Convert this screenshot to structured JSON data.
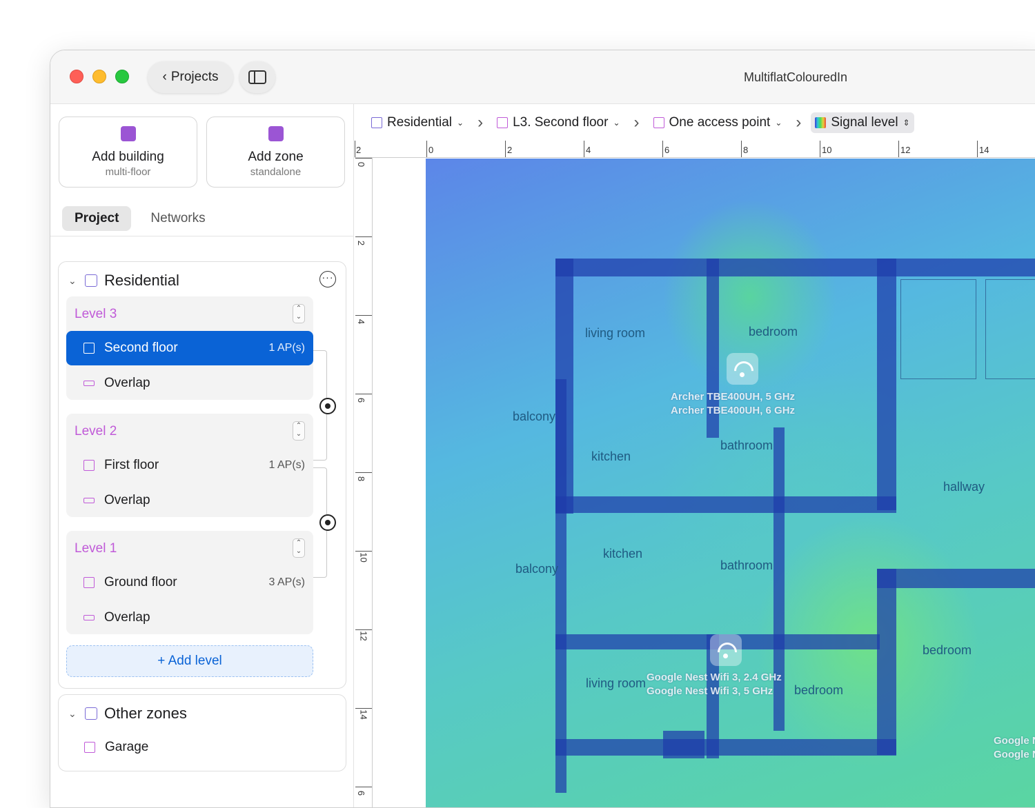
{
  "window": {
    "title": "MultiflatColouredIn",
    "back_label": "Projects"
  },
  "sidebar": {
    "add_building": {
      "title": "Add building",
      "subtitle": "multi-floor"
    },
    "add_zone": {
      "title": "Add zone",
      "subtitle": "standalone"
    },
    "tabs": [
      {
        "label": "Project",
        "active": true
      },
      {
        "label": "Networks",
        "active": false
      }
    ],
    "building": {
      "name": "Residential",
      "levels": [
        {
          "label": "Level 3",
          "floors": [
            {
              "name": "Second floor",
              "aps": "1 AP(s)",
              "selected": true
            },
            {
              "name": "Overlap",
              "aps": ""
            }
          ]
        },
        {
          "label": "Level 2",
          "floors": [
            {
              "name": "First floor",
              "aps": "1 AP(s)"
            },
            {
              "name": "Overlap",
              "aps": ""
            }
          ]
        },
        {
          "label": "Level 1",
          "floors": [
            {
              "name": "Ground floor",
              "aps": "3 AP(s)"
            },
            {
              "name": "Overlap",
              "aps": ""
            }
          ]
        }
      ],
      "add_level": "+ Add level"
    },
    "other_zones": {
      "title": "Other zones",
      "items": [
        "Garage"
      ]
    }
  },
  "breadcrumbs": [
    {
      "label": "Residential",
      "icon": "building-icon"
    },
    {
      "label": "L3. Second floor",
      "icon": "floor-icon"
    },
    {
      "label": "One access point",
      "icon": "scenario-icon"
    },
    {
      "label": "Signal level",
      "icon": "heatmap-icon",
      "selected": true
    }
  ],
  "ruler": {
    "horizontal": [
      "2",
      "0",
      "2",
      "4",
      "6",
      "8",
      "10",
      "12",
      "14"
    ],
    "vertical": [
      "0",
      "2",
      "4",
      "6",
      "8",
      "10",
      "12",
      "14",
      "6"
    ]
  },
  "floorplan": {
    "rooms": [
      "living room",
      "bedroom",
      "balcony",
      "kitchen",
      "bathroom",
      "hallway",
      "kitchen",
      "balcony",
      "bathroom",
      "bedroom",
      "living room",
      "bedroom"
    ],
    "access_points": [
      {
        "lines": [
          "Archer TBE400UH, 5 GHz",
          "Archer TBE400UH, 6 GHz"
        ]
      },
      {
        "lines": [
          "Google Nest Wifi 3, 2.4 GHz",
          "Google Nest Wifi 3, 5 GHz"
        ]
      },
      {
        "lines": [
          "Google Ne",
          "Google N"
        ]
      }
    ]
  },
  "colors": {
    "accent": "#0a63d6",
    "level_label": "#c05ad8",
    "building_icon": "#7a6ad6"
  }
}
